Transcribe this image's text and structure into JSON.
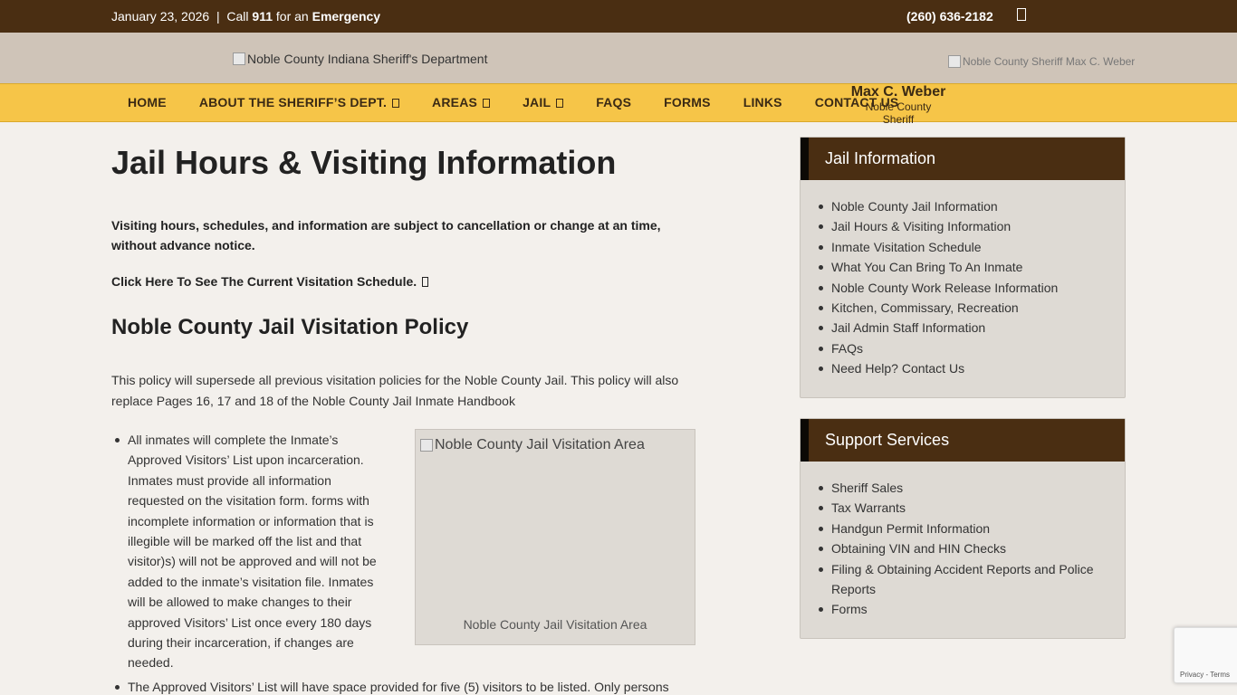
{
  "topbar": {
    "date": "January 23, 2026",
    "separator": "|",
    "call_prefix": "Call",
    "call_number": "911",
    "call_mid": "for an",
    "call_emergency": "Emergency",
    "phone": "(260) 636-2182",
    "social_icon": "facebook-icon"
  },
  "header": {
    "logo_alt": "Noble County Indiana Sheriff's Department",
    "sheriff_photo_alt": "Noble County Sheriff Max C. Weber"
  },
  "nav": {
    "items": [
      {
        "label": "HOME",
        "dropdown": false
      },
      {
        "label": "ABOUT THE SHERIFF’S DEPT.",
        "dropdown": true
      },
      {
        "label": "AREAS",
        "dropdown": true
      },
      {
        "label": "JAIL",
        "dropdown": true
      },
      {
        "label": "FAQS",
        "dropdown": false
      },
      {
        "label": "FORMS",
        "dropdown": false
      },
      {
        "label": "LINKS",
        "dropdown": false
      },
      {
        "label": "CONTACT US",
        "dropdown": false
      }
    ],
    "sheriff_name": "Max C. Weber",
    "sheriff_title": "Noble County Sheriff"
  },
  "main": {
    "title": "Jail Hours & Visiting Information",
    "notice": "Visiting hours, schedules, and information are subject to cancellation or change at an time, without advance notice.",
    "schedule_link": "Click Here To See The Current Visitation Schedule.",
    "policy_heading": "Noble County Jail Visitation Policy",
    "intro": "This policy will supersede all previous visitation policies for the Noble County Jail. This policy will also replace Pages 16, 17 and 18 of the Noble County Jail Inmate Handbook",
    "policy_items": [
      "All inmates will complete the Inmate’s Approved Visitors’ List upon incarceration. Inmates must provide all information requested on the visitation form. forms with incomplete information or information that is illegible will be marked off the list and that visitor)s) will not be approved and will not be added to the inmate’s visitation file. Inmates will be allowed to make changes to their approved Visitors’ List once every 180 days during their incarceration, if changes are needed.",
      "The Approved Visitors’ List will have space provided for five (5) visitors to be listed. Only persons"
    ],
    "figure": {
      "alt": "Noble County Jail Visitation Area",
      "caption": "Noble County Jail Visitation Area"
    }
  },
  "sidebar": {
    "jail_info": {
      "title": "Jail Information",
      "links": [
        "Noble County Jail Information",
        "Jail Hours & Visiting Information",
        "Inmate Visitation Schedule",
        "What You Can Bring To An Inmate",
        "Noble County Work Release Information",
        "Kitchen, Commissary, Recreation",
        "Jail Admin Staff Information",
        "FAQs",
        "Need Help? Contact Us"
      ]
    },
    "support": {
      "title": "Support Services",
      "links": [
        "Sheriff Sales",
        "Tax Warrants",
        "Handgun Permit Information",
        "Obtaining VIN and HIN Checks",
        "Filing & Obtaining Accident Reports and Police Reports",
        "Forms"
      ]
    }
  },
  "recaptcha": {
    "privacy": "Privacy",
    "dash": "-",
    "terms": "Terms"
  },
  "colors": {
    "topbar": "#4a2e12",
    "header": "#cfc4b8",
    "nav": "#f6c548",
    "background": "#f3f0ec"
  }
}
